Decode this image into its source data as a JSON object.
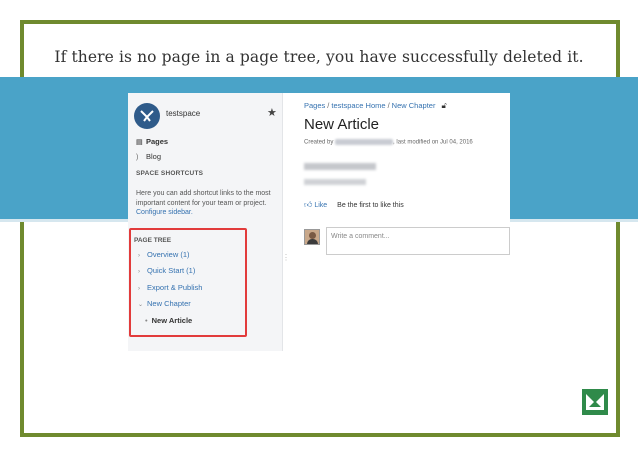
{
  "caption": "If there is no page in a page tree, you have successfully deleted it.",
  "colors": {
    "frame": "#6f8a2e",
    "band": "#4aa3c8",
    "highlight": "#e23b3b",
    "link": "#3572b0"
  },
  "sidebar": {
    "space_name": "testspace",
    "items": [
      {
        "label": "Pages",
        "icon": "pages-icon"
      },
      {
        "label": "Blog",
        "icon": "rss-icon"
      }
    ],
    "shortcuts_header": "SPACE SHORTCUTS",
    "shortcuts_text": "Here you can add shortcut links to the most important content for your team or project.",
    "shortcuts_link": "Configure sidebar.",
    "tree_header": "PAGE TREE",
    "tree": [
      {
        "label": "Overview (1)",
        "chevron": "›"
      },
      {
        "label": "Quick Start (1)",
        "chevron": "›"
      },
      {
        "label": "Export & Publish",
        "chevron": "›"
      },
      {
        "label": "New Chapter",
        "chevron": "⌄"
      }
    ],
    "current_page": "New Article"
  },
  "content": {
    "breadcrumb": [
      "Pages",
      "testspace Home",
      "New Chapter"
    ],
    "title": "New Article",
    "byline_prefix": "Created by",
    "byline_suffix": ", last modified on Jul 04, 2016",
    "like_label": "Like",
    "like_text": "Be the first to like this",
    "comment_placeholder": "Write a comment..."
  }
}
